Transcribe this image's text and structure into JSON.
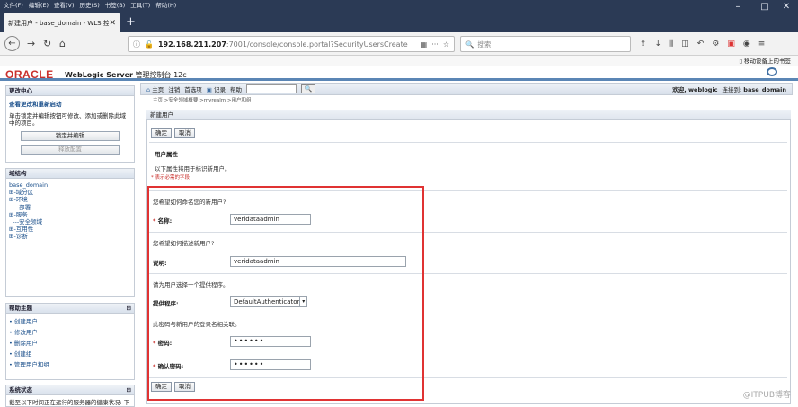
{
  "browser": {
    "menu": [
      "文件(F)",
      "编辑(E)",
      "查看(V)",
      "历史(S)",
      "书签(B)",
      "工具(T)",
      "帮助(H)"
    ],
    "tab_title": "新建用户 - base_domain - WLS 控",
    "url_host": "192.168.211.207",
    "url_path": ":7001/console/console.portal?SecurityUsersCreate",
    "search_placeholder": "搜索",
    "mobile_bookmarks": "移动设备上的书签"
  },
  "header": {
    "oracle": "ORACLE",
    "product": "WebLogic Server",
    "product_suffix": "管理控制台 12c"
  },
  "sidebar": {
    "change_center": {
      "title": "更改中心",
      "link": "查看更改和重新启动",
      "desc": "单击锁定并编辑按钮可修改、添加或删除此域中的项目。",
      "lock_button": "锁定并编辑",
      "release_button": "释放配置"
    },
    "domain_structure": {
      "title": "域结构",
      "items": [
        "base_domain",
        "⊞-域分区",
        "⊞-环境",
        "  ---部署",
        "⊞-服务",
        "  ---安全领域",
        "⊞-互用性",
        "⊞-诊断"
      ]
    },
    "help": {
      "title": "帮助主题",
      "items": [
        "• 创建用户",
        "• 修改用户",
        "• 删除用户",
        "• 创建组",
        "• 管理用户和组"
      ]
    },
    "system_status": {
      "title": "系统状态",
      "desc": "截至以下时间正在运行的服务器的健康状况: 下"
    }
  },
  "toolbar": {
    "home": "主页",
    "logout": "注销",
    "preferences": "首选项",
    "record": "记录",
    "help": "帮助",
    "welcome": "欢迎, weblogic",
    "connected": "连接到: base_domain"
  },
  "breadcrumb": "主页 >安全领域概要 >myrealm >用户和组",
  "form": {
    "title": "新建用户",
    "ok": "确定",
    "cancel": "取消",
    "section_title": "用户属性",
    "section_desc": "以下属性将用于标识新用户。",
    "required_note": "* 表示必需的字段",
    "q_name": "您希望如何命名您的新用户?",
    "name_label": "* 名称:",
    "name_value": "veridataadmin",
    "q_desc": "您希望如何描述新用户?",
    "desc_label": "说明:",
    "desc_value": "veridataadmin",
    "q_provider": "请为用户选择一个提供程序。",
    "provider_label": "提供程序:",
    "provider_value": "DefaultAuthenticator",
    "q_password": "此密码与新用户的登录名相关联。",
    "password_label": "* 密码:",
    "password_value": "••••••",
    "confirm_label": "* 确认密码:",
    "confirm_value": "••••••"
  },
  "watermark": "@ITPUB博客"
}
